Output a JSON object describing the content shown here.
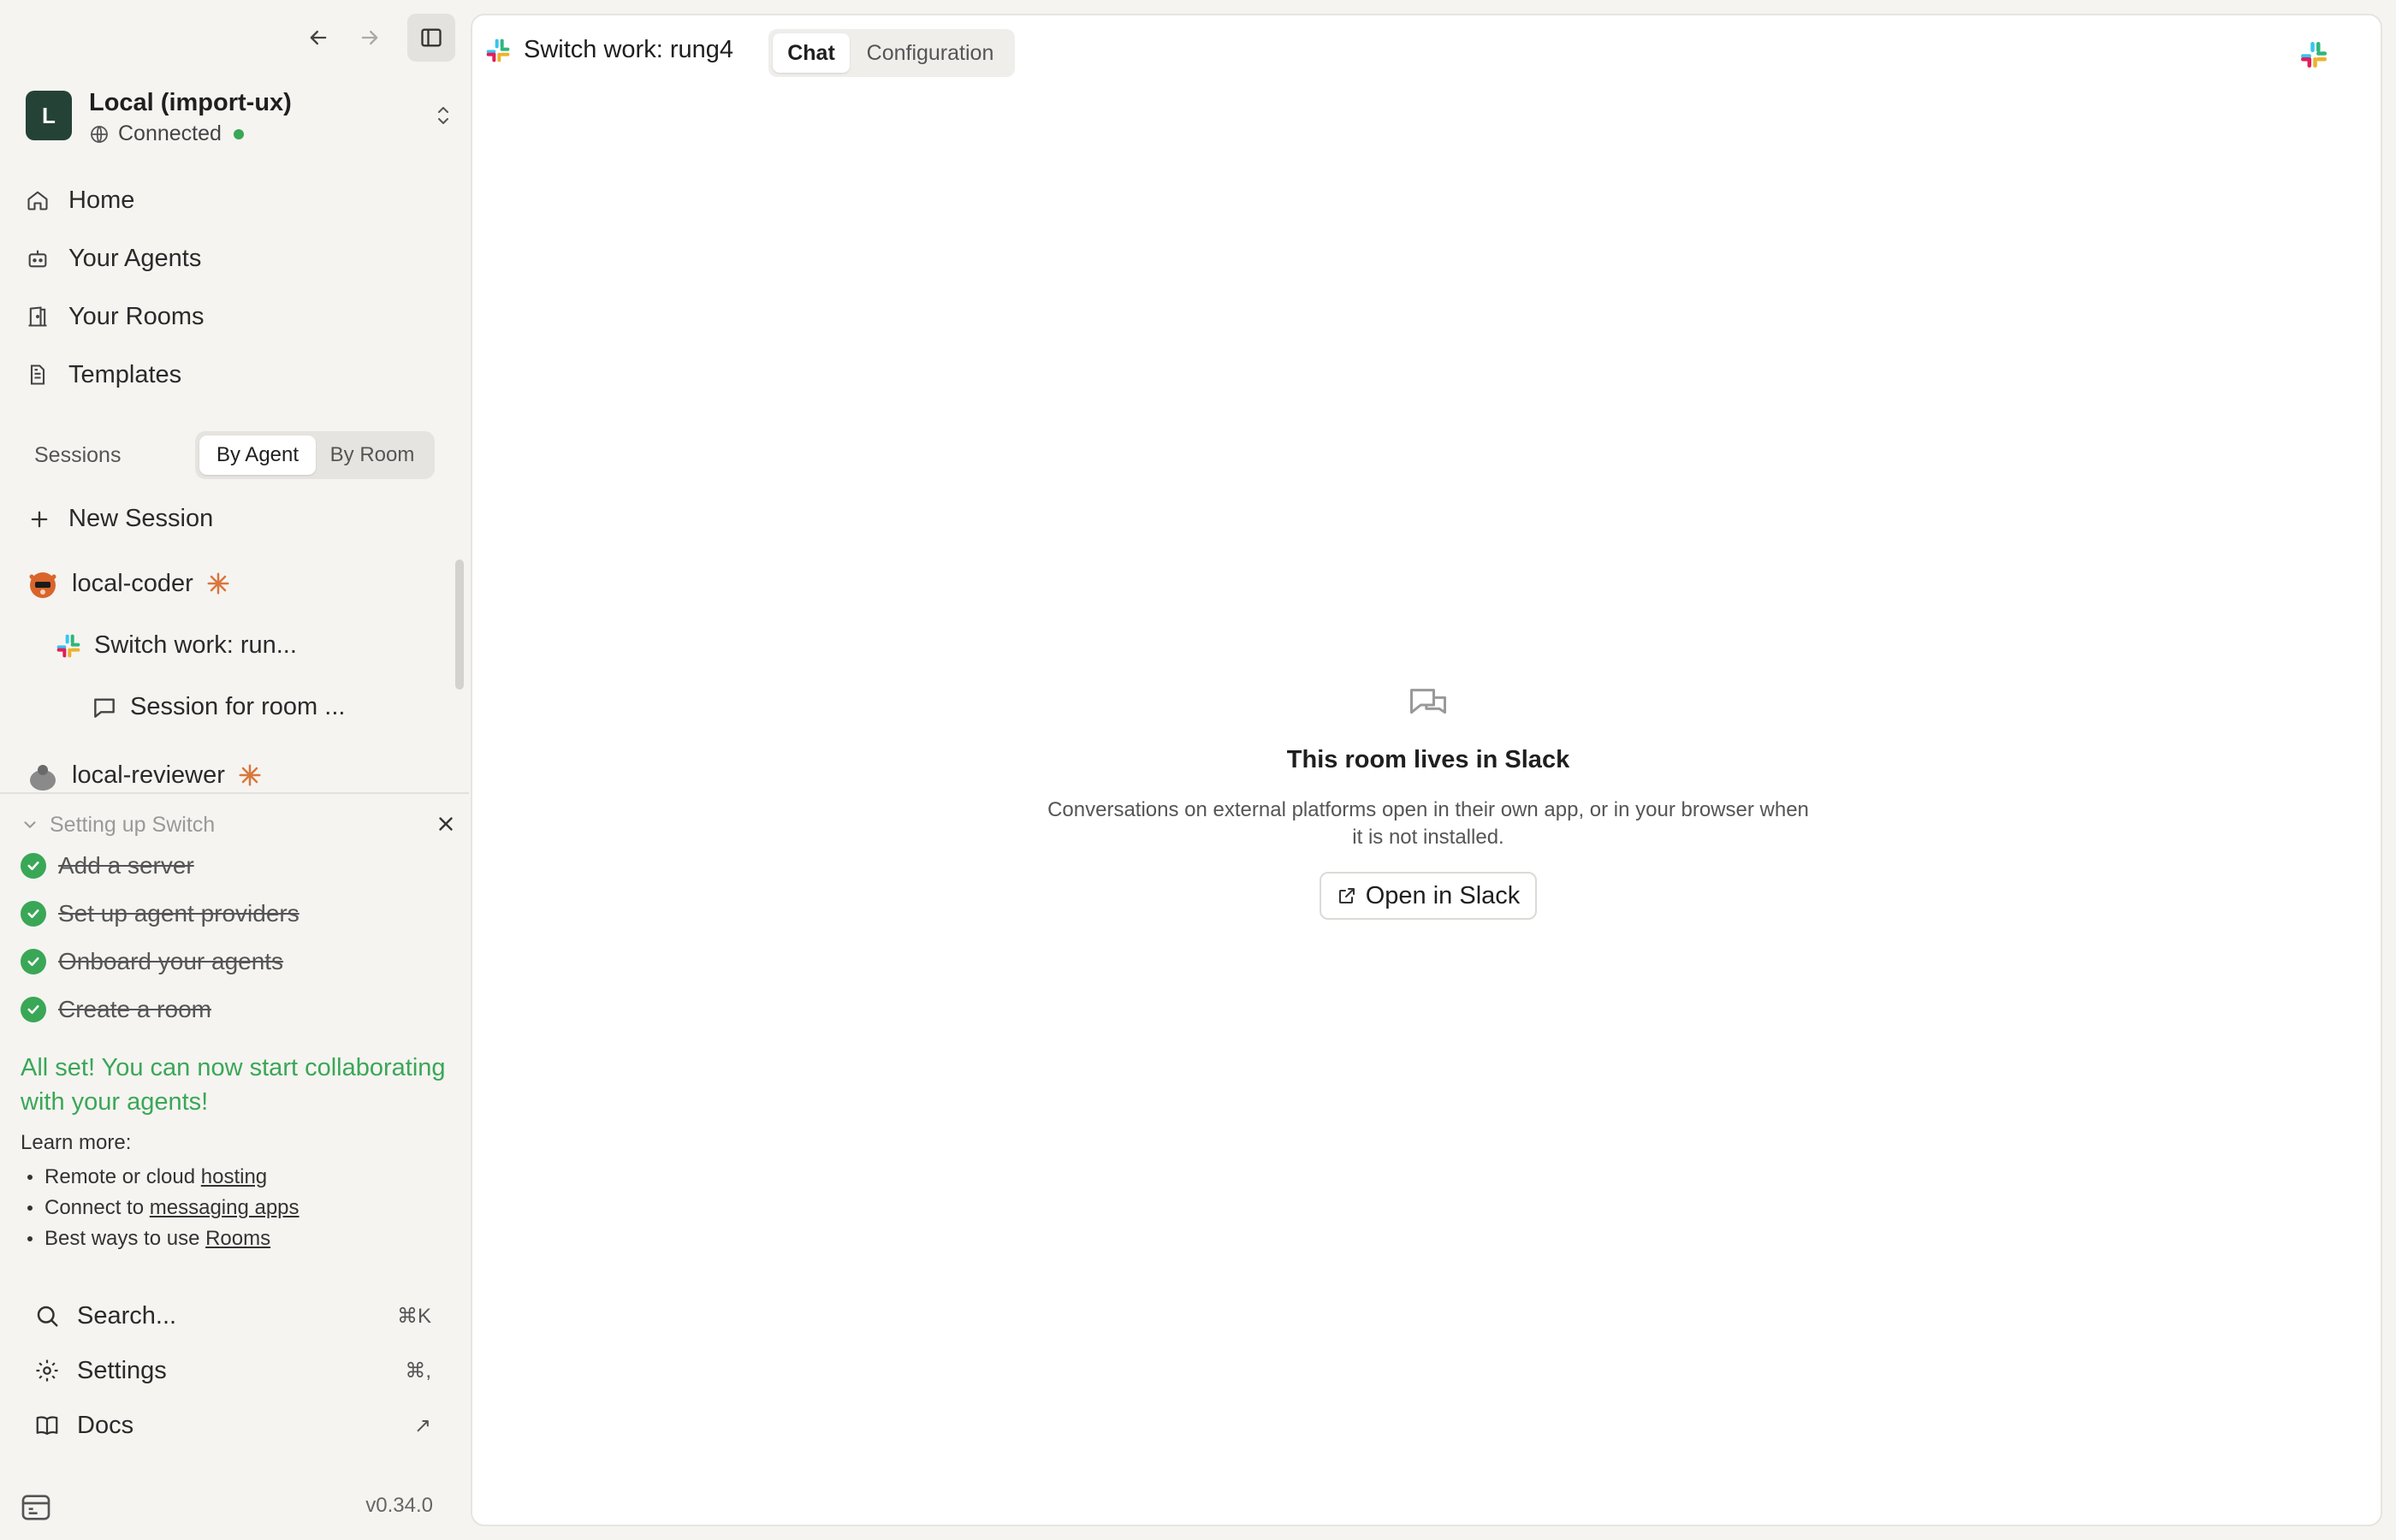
{
  "workspace": {
    "initial": "L",
    "name": "Local (import-ux)",
    "status": "Connected"
  },
  "nav": [
    {
      "label": "Home",
      "icon": "home-icon"
    },
    {
      "label": "Your Agents",
      "icon": "robot-icon"
    },
    {
      "label": "Your Rooms",
      "icon": "door-icon"
    },
    {
      "label": "Templates",
      "icon": "document-icon"
    }
  ],
  "sessions": {
    "label": "Sessions",
    "tabs": {
      "by_agent": "By Agent",
      "by_room": "By Room"
    },
    "new_session": "New Session",
    "items": [
      {
        "label": "local-coder",
        "icon": "agent-avatar-coder"
      },
      {
        "label": "Switch work: run...",
        "icon": "slack-icon"
      },
      {
        "label": "Session for room ...",
        "icon": "chat-bubble-icon"
      },
      {
        "label": "local-reviewer",
        "icon": "agent-avatar-reviewer"
      }
    ]
  },
  "setup": {
    "title": "Setting up Switch",
    "steps": [
      "Add a server",
      "Set up agent providers",
      "Onboard your agents",
      "Create a room"
    ],
    "done_message": "All set! You can now start collaborating with your agents!",
    "learn_more": "Learn more:",
    "links": [
      {
        "prefix": "Remote or cloud ",
        "link": "hosting"
      },
      {
        "prefix": "Connect to ",
        "link": "messaging apps"
      },
      {
        "prefix": "Best ways to use ",
        "link": "Rooms"
      }
    ]
  },
  "bottom": {
    "search": {
      "label": "Search...",
      "shortcut": "⌘K"
    },
    "settings": {
      "label": "Settings",
      "shortcut": "⌘,"
    },
    "docs": {
      "label": "Docs",
      "shortcut": "↗"
    }
  },
  "version": "v0.34.0",
  "main": {
    "room_title": "Switch work: rung4",
    "tabs": {
      "chat": "Chat",
      "configuration": "Configuration"
    },
    "empty_title": "This room lives in Slack",
    "empty_desc": "Conversations on external platforms open in their own app, or in your browser when it is not installed.",
    "open_button": "Open in Slack"
  },
  "colors": {
    "accent_green": "#3aa757",
    "avatar_bg": "#244236",
    "sidebar_bg": "#f5f4f1"
  }
}
